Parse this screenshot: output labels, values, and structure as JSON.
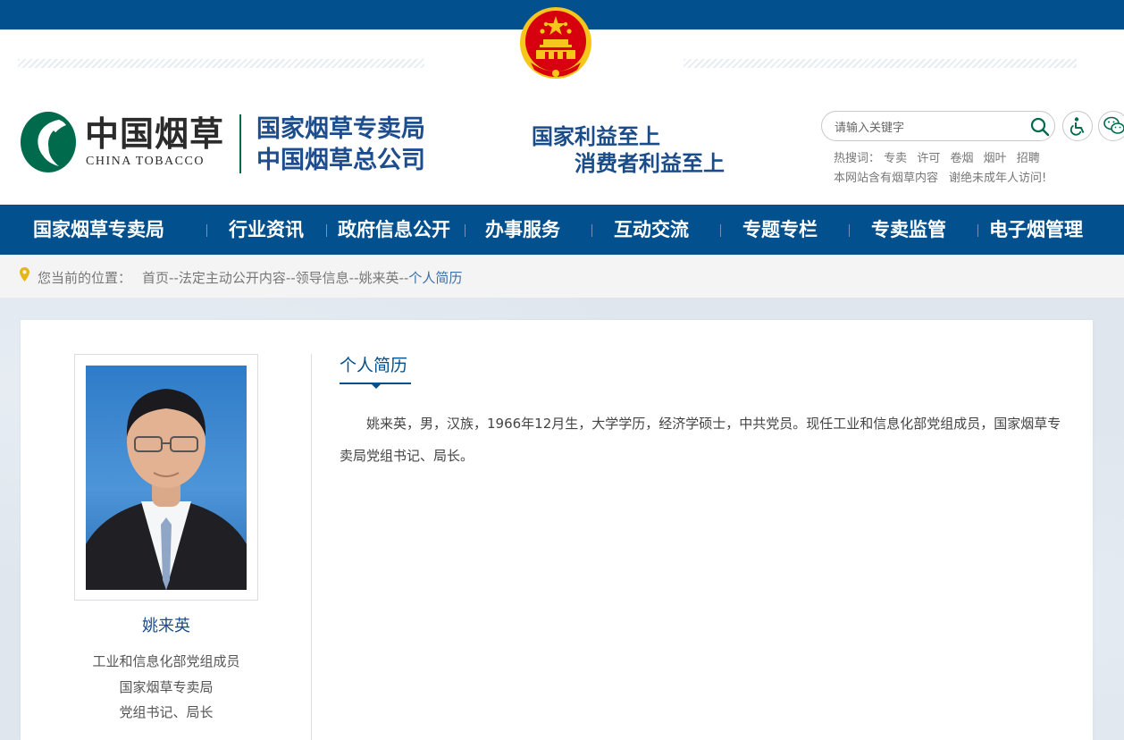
{
  "header": {
    "logo_cn": "中国烟草",
    "logo_en": "CHINA TOBACCO",
    "org_line1": "国家烟草专卖局",
    "org_line2": "中国烟草总公司",
    "slogan_line1": "国家利益至上",
    "slogan_line2": "消费者利益至上",
    "search_placeholder": "请输入关键字",
    "hot_label": "热搜词：",
    "hot_keywords": [
      "专卖",
      "许可",
      "卷烟",
      "烟叶",
      "招聘"
    ],
    "notice1": "本网站含有烟草内容",
    "notice2": "谢绝未成年人访问!"
  },
  "nav": {
    "items": [
      "国家烟草专卖局",
      "行业资讯",
      "政府信息公开",
      "办事服务",
      "互动交流",
      "专题专栏",
      "专卖监管",
      "电子烟管理"
    ]
  },
  "breadcrumb": {
    "label": "您当前的位置：",
    "path": "首页--法定主动公开内容--领导信息--姚来英--",
    "current": "个人简历"
  },
  "profile": {
    "name": "姚来英",
    "title_line1": "工业和信息化部党组成员",
    "title_line2": "国家烟草专卖局",
    "title_line3": "党组书记、局长"
  },
  "resume": {
    "title": "个人简历",
    "text": "姚来英，男，汉族，1966年12月生，大学学历，经济学硕士，中共党员。现任工业和信息化部党组成员，国家烟草专卖局党组书记、局长。"
  },
  "colors": {
    "brand_blue": "#03508e",
    "logo_green": "#006b4c",
    "emblem_red": "#d7000f",
    "emblem_gold": "#f6c61b"
  },
  "icons": [
    "national-emblem-icon",
    "china-tobacco-logo-icon",
    "search-icon",
    "accessibility-icon",
    "wechat-icon",
    "location-pin-icon"
  ]
}
